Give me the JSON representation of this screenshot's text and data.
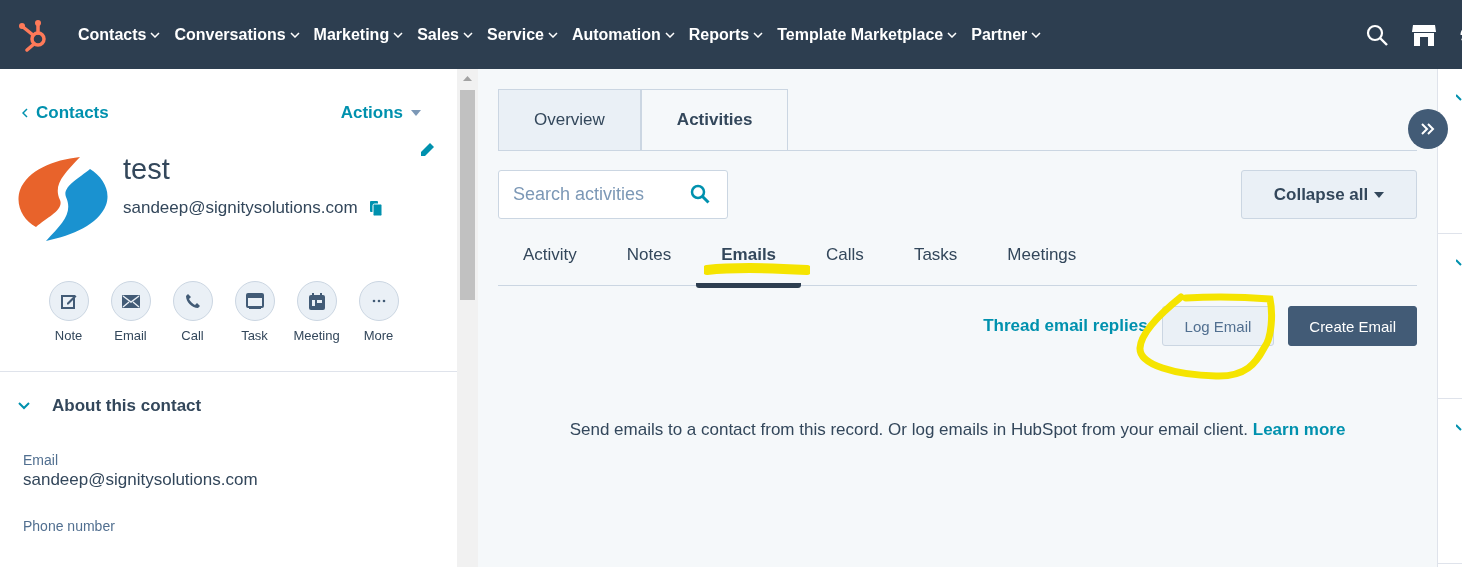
{
  "nav": {
    "items": [
      {
        "label": "Contacts"
      },
      {
        "label": "Conversations"
      },
      {
        "label": "Marketing"
      },
      {
        "label": "Sales"
      },
      {
        "label": "Service"
      },
      {
        "label": "Automation"
      },
      {
        "label": "Reports"
      },
      {
        "label": "Template Marketplace"
      },
      {
        "label": "Partner"
      }
    ]
  },
  "sidebar": {
    "back": "Contacts",
    "actions": "Actions",
    "name": "test",
    "email": "sandeep@signitysolutions.com",
    "quick_actions": [
      {
        "label": "Note",
        "kind": "note"
      },
      {
        "label": "Email",
        "kind": "email"
      },
      {
        "label": "Call",
        "kind": "call"
      },
      {
        "label": "Task",
        "kind": "task"
      },
      {
        "label": "Meeting",
        "kind": "meeting"
      },
      {
        "label": "More",
        "kind": "more"
      }
    ],
    "section": {
      "title": "About this contact",
      "expanded": true,
      "fields": [
        {
          "label": "Email",
          "value": "sandeep@signitysolutions.com"
        },
        {
          "label": "Phone number"
        }
      ]
    }
  },
  "main": {
    "tabs": [
      {
        "label": "Overview",
        "selected": false
      },
      {
        "label": "Activities",
        "selected": true
      }
    ],
    "search": {
      "placeholder": "Search activities"
    },
    "collapse": "Collapse all",
    "filters": [
      {
        "label": "Activity",
        "selected": false
      },
      {
        "label": "Notes",
        "selected": false
      },
      {
        "label": "Emails",
        "selected": true
      },
      {
        "label": "Calls",
        "selected": false
      },
      {
        "label": "Tasks",
        "selected": false
      },
      {
        "label": "Meetings",
        "selected": false
      }
    ],
    "thread_link": "Thread email replies",
    "log_button": "Log Email",
    "create_button": "Create Email",
    "empty_text": "Send emails to a contact from this record. Or log emails in HubSpot from your email client.",
    "learn_more": "Learn more"
  }
}
